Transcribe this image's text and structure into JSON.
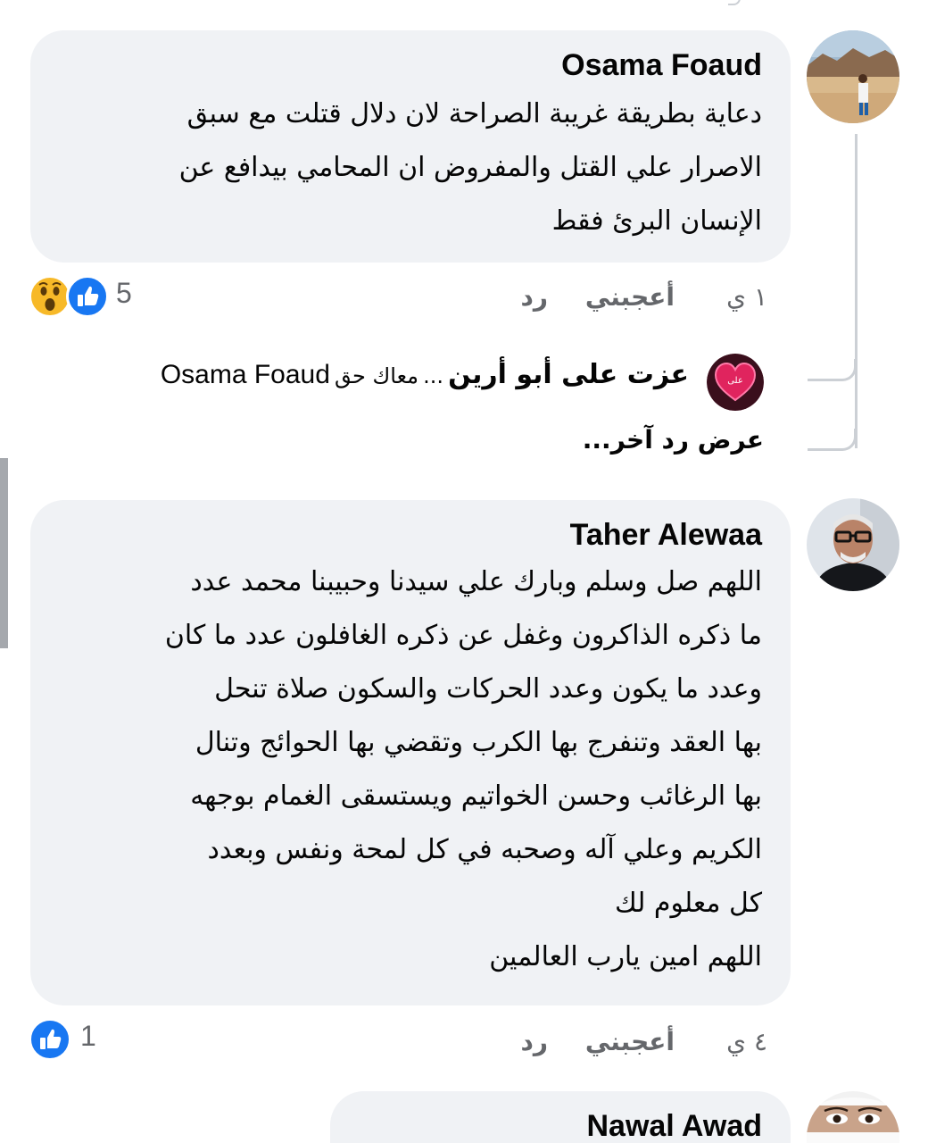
{
  "comments": [
    {
      "author": "Osama Foaud",
      "lines": [
        "دعاية بطريقة غريبة الصراحة لان دلال قتلت مع سبق",
        "الاصرار علي القتل والمفروض ان المحامي بيدافع عن",
        "الإنسان البرئ فقط"
      ],
      "time": "١ ي",
      "like_label": "أعجبني",
      "reply_label": "رد",
      "reaction_count": "5",
      "reaction_icons": [
        "wow-icon",
        "like-icon"
      ]
    },
    {
      "author": "Taher Alewaa",
      "lines": [
        "اللهم صل وسلم وبارك علي سيدنا وحبيبنا محمد عدد",
        "ما ذكره الذاكرون وغفل عن ذكره الغافلون عدد ما كان",
        "وعدد ما يكون وعدد الحركات والسكون صلاة تنحل",
        "بها العقد وتنفرج بها الكرب وتقضي بها الحوائج وتنال",
        "بها الرغائب وحسن الخواتيم ويستسقى الغمام بوجهه",
        "الكريم وعلي آله وصحبه في كل لمحة ونفس وبعدد",
        "كل معلوم لك",
        "اللهم امين يارب العالمين"
      ],
      "time": "٤ ي",
      "like_label": "أعجبني",
      "reply_label": "رد",
      "reaction_count": "1",
      "reaction_icons": [
        "like-icon"
      ]
    },
    {
      "author": "Nawal Awad"
    }
  ],
  "reply_preview": {
    "author": "عزت على أبو أرين",
    "separator": "...",
    "text": "معاك حق",
    "mention": "Osama Foaud",
    "avatar_label": "على"
  },
  "more_replies_label": "عرض رد آخر...",
  "colors": {
    "bubble": "#f0f2f5",
    "text": "#050505",
    "secondary_text": "#65676b",
    "like_blue": "#1877f2",
    "wow_yellow": "#f7b928",
    "thread_line": "#ccd0d5"
  }
}
